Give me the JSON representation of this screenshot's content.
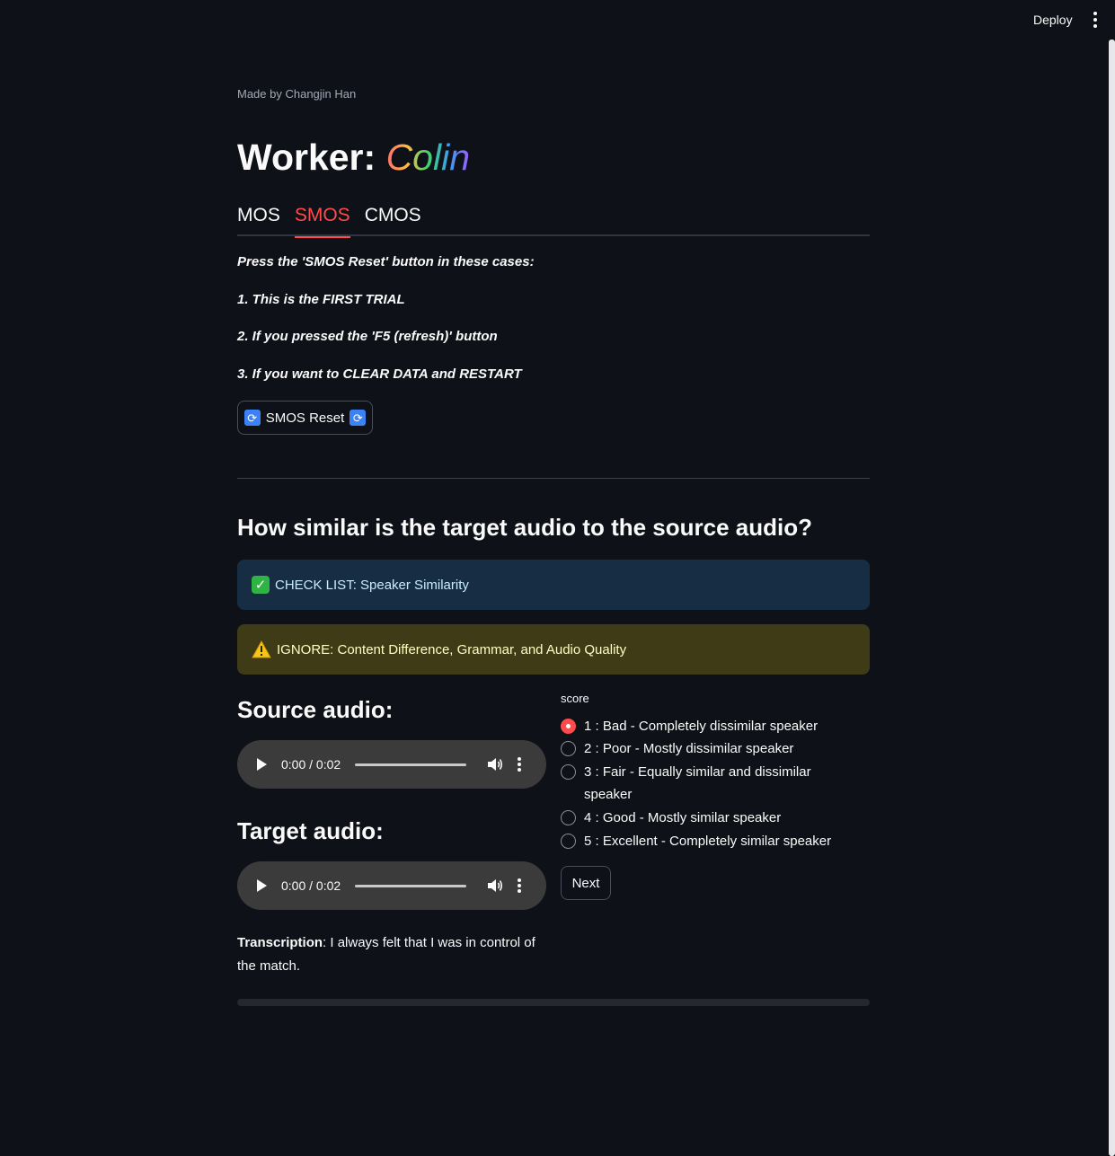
{
  "header": {
    "deploy_label": "Deploy"
  },
  "credit": "Made by Changjin Han",
  "title": {
    "prefix": "Worker: ",
    "name": "Colin"
  },
  "tabs": [
    {
      "label": "MOS",
      "active": false
    },
    {
      "label": "SMOS",
      "active": true
    },
    {
      "label": "CMOS",
      "active": false
    }
  ],
  "instructions": [
    "Press the 'SMOS Reset' button in these cases:",
    "1. This is the FIRST TRIAL",
    "2. If you pressed the 'F5 (refresh)' button",
    "3. If you want to CLEAR DATA and RESTART"
  ],
  "reset_button": {
    "label": "SMOS Reset"
  },
  "question": "How similar is the target audio to the source audio?",
  "alerts": {
    "info": "CHECK LIST: Speaker Similarity",
    "warning": "IGNORE: Content Difference, Grammar, and Audio Quality"
  },
  "source": {
    "heading": "Source audio:",
    "time": "0:00 / 0:02"
  },
  "target": {
    "heading": "Target audio:",
    "time": "0:00 / 0:02"
  },
  "transcription": {
    "label": "Transcription",
    "text": ": I always felt that I was in control of the match."
  },
  "score": {
    "label": "score",
    "options": [
      "1 : Bad - Completely dissimilar speaker",
      "2 : Poor - Mostly dissimilar speaker",
      "3 : Fair - Equally similar and dissimilar speaker",
      "4 : Good - Mostly similar speaker",
      "5 : Excellent - Completely similar speaker"
    ],
    "selected": "1 : Bad - Completely dissimilar speaker"
  },
  "next_button": {
    "label": "Next"
  },
  "colors": {
    "accent": "#ff4b4b",
    "background": "#0e1117",
    "info_bg": "#172d43",
    "warning_bg": "#3e3b16"
  },
  "icons": [
    "kebab-menu-icon",
    "refresh-icon",
    "check-icon",
    "warning-icon",
    "play-icon",
    "volume-icon",
    "more-options-icon"
  ]
}
